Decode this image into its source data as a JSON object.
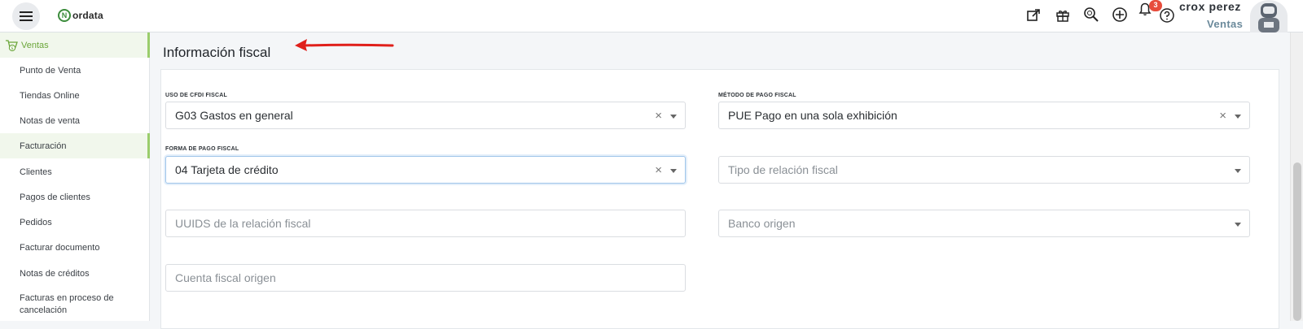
{
  "app": {
    "logo_text": "ordata",
    "logo_letter": "N"
  },
  "header": {
    "notification_count": "3",
    "user_name": "crox perez",
    "user_role": "Ventas",
    "icons": [
      "external-link-icon",
      "gift-icon",
      "search-zoom-icon",
      "plus-circle-icon",
      "bell-icon",
      "help-icon"
    ]
  },
  "sidebar": {
    "section": "Ventas",
    "items": [
      {
        "label": "Punto de Venta"
      },
      {
        "label": "Tiendas Online"
      },
      {
        "label": "Notas de venta"
      },
      {
        "label": "Facturación",
        "active": true
      },
      {
        "label": "Clientes"
      },
      {
        "label": "Pagos de clientes"
      },
      {
        "label": "Pedidos"
      },
      {
        "label": "Facturar documento"
      },
      {
        "label": "Notas de créditos"
      },
      {
        "label": "Facturas en proceso de cancelación"
      }
    ]
  },
  "page": {
    "title": "Información fiscal"
  },
  "form": {
    "uso_cfdi": {
      "label": "USO DE CFDI FISCAL",
      "value": "G03 Gastos en general"
    },
    "metodo_pago": {
      "label": "MÉTODO DE PAGO FISCAL",
      "value": "PUE Pago en una sola exhibición"
    },
    "forma_pago": {
      "label": "FORMA DE PAGO FISCAL",
      "value": "04 Tarjeta de crédito"
    },
    "tipo_relacion": {
      "placeholder": "Tipo de relación fiscal"
    },
    "uuids": {
      "placeholder": "UUIDS de la relación fiscal"
    },
    "banco_origen": {
      "placeholder": "Banco origen"
    },
    "cuenta_origen": {
      "placeholder": "Cuenta fiscal origen"
    }
  },
  "colors": {
    "accent_green": "#9acd6b",
    "annotation_red": "#e0201b",
    "badge_red": "#e74c3c"
  }
}
